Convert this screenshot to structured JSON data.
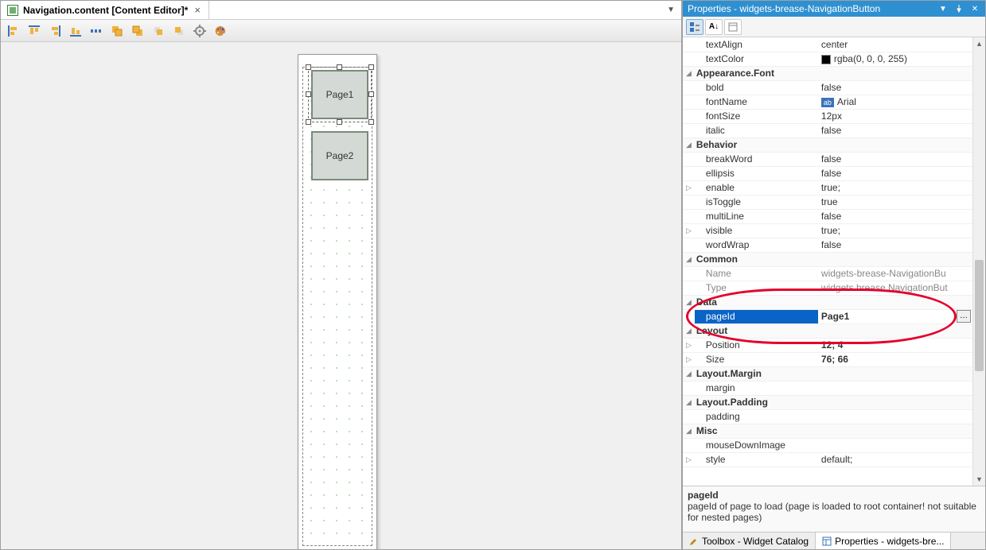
{
  "editor": {
    "tab_title": "Navigation.content [Content Editor]*",
    "toolbar_icons": [
      "align-left",
      "align-top",
      "align-right",
      "align-bottom",
      "distribute-h",
      "bring-front",
      "send-back",
      "bring-forward",
      "send-backward",
      "settings",
      "palette"
    ],
    "widgets": [
      {
        "label": "Page1"
      },
      {
        "label": "Page2"
      }
    ]
  },
  "properties": {
    "panel_title": "Properties - widgets-brease-NavigationButton",
    "rows": [
      {
        "type": "prop",
        "key": "textAlign",
        "val": "center"
      },
      {
        "type": "prop",
        "key": "textColor",
        "val": "rgba(0, 0, 0, 255)",
        "swatch": true
      },
      {
        "type": "cat",
        "key": "Appearance.Font"
      },
      {
        "type": "prop",
        "key": "bold",
        "val": "false"
      },
      {
        "type": "prop",
        "key": "fontName",
        "val": "Arial",
        "ab": true
      },
      {
        "type": "prop",
        "key": "fontSize",
        "val": "12px"
      },
      {
        "type": "prop",
        "key": "italic",
        "val": "false"
      },
      {
        "type": "cat",
        "key": "Behavior"
      },
      {
        "type": "prop",
        "key": "breakWord",
        "val": "false"
      },
      {
        "type": "prop",
        "key": "ellipsis",
        "val": "false"
      },
      {
        "type": "prop",
        "key": "enable",
        "val": "true;",
        "expand": true
      },
      {
        "type": "prop",
        "key": "isToggle",
        "val": "true"
      },
      {
        "type": "prop",
        "key": "multiLine",
        "val": "false"
      },
      {
        "type": "prop",
        "key": "visible",
        "val": "true;",
        "expand": true
      },
      {
        "type": "prop",
        "key": "wordWrap",
        "val": "false"
      },
      {
        "type": "cat",
        "key": "Common"
      },
      {
        "type": "prop",
        "key": "Name",
        "val": "widgets-brease-NavigationBu",
        "dim": true
      },
      {
        "type": "prop",
        "key": "Type",
        "val": "widgets.brease.NavigationBut",
        "dim": true
      },
      {
        "type": "cat",
        "key": "Data",
        "hl": true
      },
      {
        "type": "prop",
        "key": "pageId",
        "val": "Page1",
        "sel": true,
        "bold": true,
        "hl": true,
        "ellipsis": true
      },
      {
        "type": "cat",
        "key": "Layout",
        "hl": true
      },
      {
        "type": "prop",
        "key": "Position",
        "val": "12; 4",
        "bold": true,
        "expand": true
      },
      {
        "type": "prop",
        "key": "Size",
        "val": "76; 66",
        "bold": true,
        "expand": true
      },
      {
        "type": "cat",
        "key": "Layout.Margin"
      },
      {
        "type": "prop",
        "key": "margin",
        "val": ""
      },
      {
        "type": "cat",
        "key": "Layout.Padding"
      },
      {
        "type": "prop",
        "key": "padding",
        "val": ""
      },
      {
        "type": "cat",
        "key": "Misc"
      },
      {
        "type": "prop",
        "key": "mouseDownImage",
        "val": ""
      },
      {
        "type": "prop",
        "key": "style",
        "val": "default;",
        "expand": true
      }
    ],
    "desc": {
      "title": "pageId",
      "body": "pageId of page to load (page is loaded to root container! not suitable for nested pages)"
    },
    "bottom_tabs": {
      "toolbox": "Toolbox - Widget Catalog",
      "props": "Properties - widgets-bre..."
    }
  }
}
